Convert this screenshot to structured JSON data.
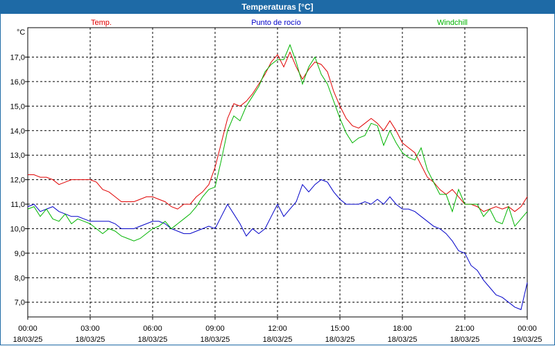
{
  "chart_data": {
    "type": "line",
    "title": "Temperaturas [°C]",
    "ylabel": "°C",
    "ylim": [
      6.4,
      18.2
    ],
    "yticks": [
      7.0,
      8.0,
      9.0,
      10.0,
      11.0,
      12.0,
      13.0,
      14.0,
      15.0,
      16.0,
      17.0
    ],
    "ytick_labels": [
      "7,0",
      "8,0",
      "9,0",
      "10,0",
      "11,0",
      "12,0",
      "13,0",
      "14,0",
      "15,0",
      "16,0",
      "17,0"
    ],
    "xlim_hours": [
      0,
      24
    ],
    "xticks": [
      {
        "h": 0,
        "time": "00:00",
        "date": "18/03/25"
      },
      {
        "h": 3,
        "time": "03:00",
        "date": "18/03/25"
      },
      {
        "h": 6,
        "time": "06:00",
        "date": "18/03/25"
      },
      {
        "h": 9,
        "time": "09:00",
        "date": "18/03/25"
      },
      {
        "h": 12,
        "time": "12:00",
        "date": "18/03/25"
      },
      {
        "h": 15,
        "time": "15:00",
        "date": "18/03/25"
      },
      {
        "h": 18,
        "time": "18:00",
        "date": "18/03/25"
      },
      {
        "h": 21,
        "time": "21:00",
        "date": "18/03/25"
      },
      {
        "h": 24,
        "time": "00:00",
        "date": "19/03/25"
      }
    ],
    "grid": true,
    "series": [
      {
        "name": "Temp.",
        "color": "#e00000",
        "x": [
          0,
          0.3,
          0.6,
          0.9,
          1.2,
          1.5,
          1.8,
          2.1,
          2.4,
          2.7,
          3.0,
          3.3,
          3.6,
          3.9,
          4.2,
          4.5,
          4.8,
          5.1,
          5.4,
          5.7,
          6.0,
          6.3,
          6.6,
          6.9,
          7.2,
          7.5,
          7.8,
          8.1,
          8.4,
          8.7,
          9.0,
          9.3,
          9.6,
          9.9,
          10.2,
          10.5,
          10.8,
          11.1,
          11.4,
          11.7,
          12.0,
          12.3,
          12.6,
          12.9,
          13.2,
          13.5,
          13.8,
          14.1,
          14.4,
          14.7,
          15.0,
          15.3,
          15.6,
          15.9,
          16.2,
          16.5,
          16.8,
          17.1,
          17.4,
          17.7,
          18.0,
          18.3,
          18.6,
          18.9,
          19.2,
          19.5,
          19.8,
          20.1,
          20.4,
          20.7,
          21.0,
          21.3,
          21.6,
          21.9,
          22.2,
          22.5,
          22.8,
          23.1,
          23.4,
          23.7,
          24.0
        ],
        "values": [
          12.2,
          12.2,
          12.1,
          12.1,
          12.0,
          11.8,
          11.9,
          12.0,
          12.0,
          12.0,
          12.0,
          11.9,
          11.6,
          11.5,
          11.3,
          11.1,
          11.1,
          11.1,
          11.2,
          11.3,
          11.3,
          11.2,
          11.1,
          10.9,
          10.8,
          11.0,
          11.0,
          11.3,
          11.5,
          11.8,
          12.5,
          13.5,
          14.5,
          15.1,
          15.0,
          15.2,
          15.5,
          15.9,
          16.3,
          16.8,
          17.1,
          16.6,
          17.2,
          16.6,
          16.1,
          16.5,
          16.8,
          16.7,
          16.4,
          15.6,
          15.0,
          14.5,
          14.2,
          14.1,
          14.3,
          14.5,
          14.3,
          14.0,
          14.4,
          14.0,
          13.5,
          13.3,
          13.1,
          12.6,
          12.1,
          11.9,
          11.6,
          11.4,
          11.6,
          11.3,
          11.0,
          11.0,
          10.9,
          10.7,
          10.8,
          10.9,
          10.8,
          10.9,
          10.7,
          10.9,
          11.3
        ]
      },
      {
        "name": "Punto de rocío",
        "color": "#0000c8",
        "x": [
          0,
          0.3,
          0.6,
          0.9,
          1.2,
          1.5,
          1.8,
          2.1,
          2.4,
          2.7,
          3.0,
          3.3,
          3.6,
          3.9,
          4.2,
          4.5,
          4.8,
          5.1,
          5.4,
          5.7,
          6.0,
          6.3,
          6.6,
          6.9,
          7.2,
          7.5,
          7.8,
          8.1,
          8.4,
          8.7,
          9.0,
          9.3,
          9.6,
          9.9,
          10.2,
          10.5,
          10.8,
          11.1,
          11.4,
          11.7,
          12.0,
          12.3,
          12.6,
          12.9,
          13.2,
          13.5,
          13.8,
          14.1,
          14.4,
          14.7,
          15.0,
          15.3,
          15.6,
          15.9,
          16.2,
          16.5,
          16.8,
          17.1,
          17.4,
          17.7,
          18.0,
          18.3,
          18.6,
          18.9,
          19.2,
          19.5,
          19.8,
          20.1,
          20.4,
          20.7,
          21.0,
          21.3,
          21.6,
          21.9,
          22.2,
          22.5,
          22.8,
          23.1,
          23.4,
          23.7,
          24.0
        ],
        "values": [
          10.9,
          11.0,
          10.7,
          10.8,
          10.9,
          10.7,
          10.6,
          10.5,
          10.5,
          10.4,
          10.3,
          10.3,
          10.3,
          10.3,
          10.2,
          10.0,
          10.0,
          10.0,
          10.1,
          10.2,
          10.3,
          10.3,
          10.2,
          10.0,
          9.9,
          9.8,
          9.8,
          9.9,
          10.0,
          10.1,
          10.0,
          10.5,
          11.0,
          10.6,
          10.2,
          9.7,
          10.0,
          9.8,
          10.0,
          10.5,
          11.0,
          10.5,
          10.8,
          11.1,
          11.8,
          11.5,
          11.8,
          12.0,
          11.9,
          11.5,
          11.2,
          11.0,
          11.0,
          11.0,
          11.1,
          11.0,
          11.2,
          11.0,
          11.3,
          11.0,
          10.8,
          10.8,
          10.7,
          10.5,
          10.3,
          10.1,
          10.0,
          9.8,
          9.5,
          9.1,
          9.0,
          8.5,
          8.3,
          7.9,
          7.6,
          7.3,
          7.2,
          7.0,
          6.8,
          6.7,
          7.8
        ]
      },
      {
        "name": "Windchill",
        "color": "#00b400",
        "x": [
          0,
          0.3,
          0.6,
          0.9,
          1.2,
          1.5,
          1.8,
          2.1,
          2.4,
          2.7,
          3.0,
          3.3,
          3.6,
          3.9,
          4.2,
          4.5,
          4.8,
          5.1,
          5.4,
          5.7,
          6.0,
          6.3,
          6.6,
          6.9,
          7.2,
          7.5,
          7.8,
          8.1,
          8.4,
          8.7,
          9.0,
          9.3,
          9.6,
          9.9,
          10.2,
          10.5,
          10.8,
          11.1,
          11.4,
          11.7,
          12.0,
          12.3,
          12.6,
          12.9,
          13.2,
          13.5,
          13.8,
          14.1,
          14.4,
          14.7,
          15.0,
          15.3,
          15.6,
          15.9,
          16.2,
          16.5,
          16.8,
          17.1,
          17.4,
          17.7,
          18.0,
          18.3,
          18.6,
          18.9,
          19.2,
          19.5,
          19.8,
          20.1,
          20.4,
          20.7,
          21.0,
          21.3,
          21.6,
          21.9,
          22.2,
          22.5,
          22.8,
          23.1,
          23.4,
          23.7,
          24.0
        ],
        "values": [
          10.8,
          10.9,
          10.5,
          10.8,
          10.4,
          10.3,
          10.6,
          10.2,
          10.4,
          10.3,
          10.2,
          10.0,
          9.8,
          10.0,
          9.9,
          9.7,
          9.6,
          9.5,
          9.6,
          9.8,
          10.0,
          10.1,
          10.3,
          10.0,
          10.2,
          10.4,
          10.6,
          10.9,
          11.3,
          11.6,
          11.7,
          12.8,
          14.0,
          14.6,
          14.4,
          15.0,
          15.4,
          15.8,
          16.4,
          16.7,
          16.9,
          16.9,
          17.5,
          16.8,
          15.9,
          16.6,
          17.0,
          16.3,
          15.9,
          15.2,
          14.5,
          13.9,
          13.5,
          13.7,
          13.8,
          14.3,
          14.2,
          13.4,
          14.0,
          13.5,
          13.1,
          12.9,
          12.8,
          13.3,
          12.4,
          11.9,
          11.4,
          11.4,
          10.7,
          11.6,
          11.0,
          11.0,
          11.0,
          10.5,
          10.8,
          10.3,
          10.2,
          10.9,
          10.1,
          10.4,
          10.7
        ]
      }
    ]
  }
}
